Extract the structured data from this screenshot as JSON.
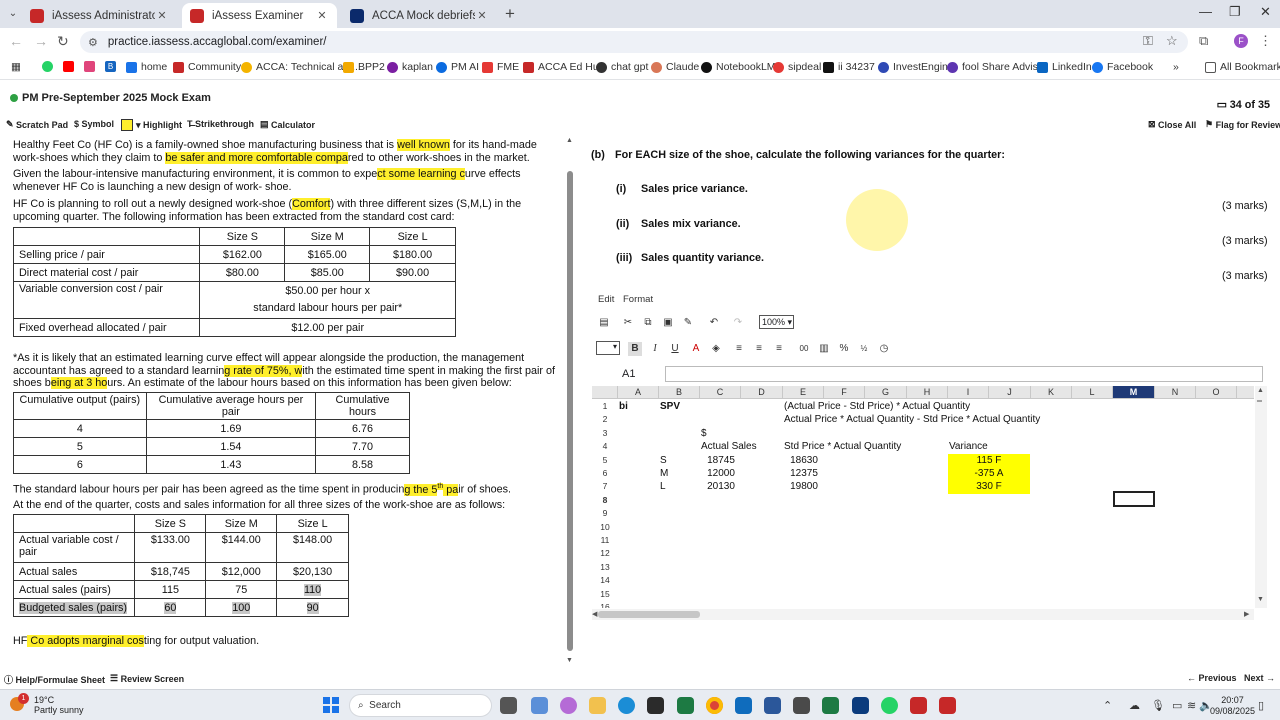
{
  "browser": {
    "tabs": [
      {
        "title": "iAssess Administrator",
        "color": "#c62828"
      },
      {
        "title": "iAssess Examiner",
        "color": "#c62828"
      },
      {
        "title": "ACCA Mock debriefs PM on Vi...",
        "color": "#0b2a6b"
      }
    ],
    "url": "practice.iassess.accaglobal.com/examiner/",
    "profile_initial": "F",
    "all_bookmarks": "All Bookmarks",
    "bookmarks": [
      "home",
      "Community",
      "ACCA: Technical arti...",
      "BPP2",
      "kaplan",
      "PM AI",
      "FME",
      "ACCA Ed Hub",
      "chat gpt",
      "Claude",
      "NotebookLM",
      "sipdeal",
      "ii 34237",
      "InvestEngine",
      "fool Share Advisor",
      "LinkedIn",
      "Facebook"
    ],
    "bookmark_b_label": "B"
  },
  "exam": {
    "title": "PM Pre-September 2025 Mock Exam",
    "question_counter": "34 of 35",
    "toolbar": {
      "scratch_pad": "Scratch Pad",
      "symbol": "Symbol",
      "highlight": "Highlight",
      "strikethrough": "Strikethrough",
      "calculator": "Calculator",
      "close_all": "Close All",
      "flag": "Flag for Review"
    }
  },
  "scenario": {
    "p1_a": "Healthy Feet Co (HF Co) is a family-owned shoe manufacturing business that is ",
    "p1_hl1": "well known",
    "p1_b": " for its hand-made work-shoes which they claim to ",
    "p1_hl2": "be safer and more comfortable compa",
    "p1_c": "red to other work-shoes in the market.",
    "p2_a": "Given the labour-intensive manufacturing environment, it is common to expe",
    "p2_hl": "ct some learning c",
    "p2_b": "urve effects whenever HF Co is launching a new design of work- shoe.",
    "p3_a": "HF Co is planning to roll out a newly designed work-shoe (",
    "p3_hl": "Comfort",
    "p3_b": ") with three different sizes (S,M,L) in the upcoming quarter. The following information has been extracted from the standard cost card:",
    "cost_card": {
      "headers": [
        "",
        "Size S",
        "Size M",
        "Size L"
      ],
      "rows": [
        [
          "Selling price / pair",
          "$162.00",
          "$165.00",
          "$180.00"
        ],
        [
          "Direct material cost / pair",
          "$80.00",
          "$85.00",
          "$90.00"
        ]
      ],
      "conv_label": "Variable conversion cost / pair",
      "conv_value1": "$50.00 per hour x",
      "conv_value2": "standard labour hours per pair*",
      "fixed_label": "Fixed overhead allocated / pair",
      "fixed_value": "$12.00 per pair"
    },
    "p4_a": "*As it is likely that an estimated learning curve effect will appear alongside the production, the management accountant has agreed to a standard learnin",
    "p4_hl1": "g rate of 75%, w",
    "p4_b": "ith the estimated time spent in making the first pair of shoes b",
    "p4_hl2": "eing at 3 ho",
    "p4_c": "urs. An estimate of the labour hours based on this information has been given below:",
    "labour_table": {
      "headers": [
        "Cumulative output (pairs)",
        "Cumulative average hours per pair",
        "Cumulative hours"
      ],
      "rows": [
        [
          "4",
          "1.69",
          "6.76"
        ],
        [
          "5",
          "1.54",
          "7.70"
        ],
        [
          "6",
          "1.43",
          "8.58"
        ]
      ]
    },
    "p5_a": "The standard labour hours per pair has been agreed as the time spent in producin",
    "p5_hl1": "g the 5",
    "p5_sup": "th",
    "p5_hl2": " pa",
    "p5_b": "ir of shoes.",
    "p6": "At the end of the quarter, costs and sales information for all three sizes of the work-shoe are as follows:",
    "actual_table": {
      "headers": [
        "",
        "Size S",
        "Size M",
        "Size L"
      ],
      "rows": [
        [
          "Actual variable cost / pair",
          "$133.00",
          "$144.00",
          "$148.00"
        ],
        [
          "Actual sales",
          "$18,745",
          "$12,000",
          "$20,130"
        ],
        [
          "Actual sales (pairs)",
          "115",
          "75",
          "110"
        ],
        [
          "Budgeted sales (pairs)",
          "60",
          "100",
          "90"
        ]
      ]
    },
    "p7_a": "HF",
    "p7_hl": " Co adopts marginal cos",
    "p7_b": "ting for output valuation."
  },
  "question": {
    "part": "(b)",
    "intro": "For EACH size of the shoe, calculate the following variances for the quarter:",
    "items": [
      {
        "num": "(i)",
        "text": "Sales price variance.",
        "marks": "(3 marks)"
      },
      {
        "num": "(ii)",
        "text": "Sales mix variance.",
        "marks": "(3 marks)"
      },
      {
        "num": "(iii)",
        "text": "Sales quantity variance.",
        "marks": "(3 marks)"
      }
    ]
  },
  "spreadsheet": {
    "menu": [
      "Edit",
      "Format"
    ],
    "zoom": "100%",
    "name_box": "A1",
    "columns": [
      "A",
      "B",
      "C",
      "D",
      "E",
      "F",
      "G",
      "H",
      "I",
      "J",
      "K",
      "L",
      "M",
      "N",
      "O"
    ],
    "rows": [
      "1",
      "2",
      "3",
      "4",
      "5",
      "6",
      "7",
      "8",
      "9",
      "10",
      "11",
      "12",
      "13",
      "14",
      "15",
      "16"
    ],
    "selected_col": "M",
    "selected_row": "8",
    "cells": {
      "A1": "bi",
      "B1": "SPV",
      "E1": "(Actual Price - Std Price) * Actual Quantity",
      "E2": "Actual Price * Actual Quantity - Std Price * Actual Quantity",
      "C3": "$",
      "C4": "Actual Sales",
      "E4": "Std Price * Actual Quantity",
      "I4": "Variance",
      "B5": "S",
      "C5": "18745",
      "E5": "18630",
      "I5": "115 F",
      "B6": "M",
      "C6": "12000",
      "E6": "12375",
      "I6": "-375 A",
      "B7": "L",
      "C7": "20130",
      "E7": "19800",
      "I7": "330 F"
    }
  },
  "footer": {
    "help": "Help/Formulae Sheet",
    "review": "Review Screen",
    "previous": "Previous",
    "next": "Next"
  },
  "taskbar": {
    "temp": "19°C",
    "weather": "Partly sunny",
    "badge": "1",
    "search": "Search",
    "time": "20:07",
    "date": "09/08/2025"
  }
}
